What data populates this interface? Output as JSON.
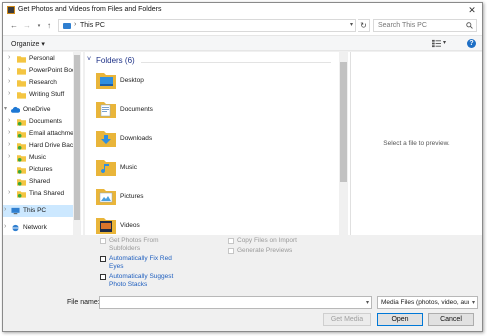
{
  "window": {
    "title": "Get Photos and Videos from Files and Folders"
  },
  "address": {
    "location": "This PC"
  },
  "search": {
    "placeholder": "Search This PC"
  },
  "toolbar": {
    "organize": "Organize ▾"
  },
  "nav_tree": [
    {
      "label": "Personal",
      "icon": "folder-icon",
      "selected": false
    },
    {
      "label": "PowerPoint Boo",
      "icon": "folder-icon",
      "selected": false
    },
    {
      "label": "Research",
      "icon": "folder-icon",
      "selected": false
    },
    {
      "label": "Writing Stuff",
      "icon": "folder-icon",
      "selected": false
    },
    {
      "label": "OneDrive",
      "icon": "cloud-icon",
      "selected": false
    },
    {
      "label": "Documents",
      "icon": "synced-folder-icon",
      "selected": false
    },
    {
      "label": "Email attachmer",
      "icon": "synced-folder-icon",
      "selected": false
    },
    {
      "label": "Hard Drive Backu",
      "icon": "synced-folder-icon",
      "selected": false
    },
    {
      "label": "Music",
      "icon": "synced-folder-icon",
      "selected": false
    },
    {
      "label": "Pictures",
      "icon": "synced-folder-icon",
      "selected": false
    },
    {
      "label": "Shared",
      "icon": "synced-folder-icon",
      "selected": false
    },
    {
      "label": "Tina Shared",
      "icon": "synced-folder-icon",
      "selected": false
    },
    {
      "label": "This PC",
      "icon": "pc-icon",
      "selected": true
    },
    {
      "label": "Network",
      "icon": "network-icon",
      "selected": false
    }
  ],
  "folders_group": {
    "label": "Folders (6)"
  },
  "folders": [
    {
      "label": "Desktop",
      "icon": "desktop-folder-icon"
    },
    {
      "label": "Documents",
      "icon": "documents-folder-icon"
    },
    {
      "label": "Downloads",
      "icon": "downloads-folder-icon"
    },
    {
      "label": "Music",
      "icon": "music-folder-icon"
    },
    {
      "label": "Pictures",
      "icon": "pictures-folder-icon"
    },
    {
      "label": "Videos",
      "icon": "videos-folder-icon"
    }
  ],
  "preview": {
    "text": "Select a file to preview."
  },
  "options": {
    "subfolders_line1": "Get Photos From",
    "subfolders_line2": "Subfolders",
    "fix_red_eyes_line1": "Automatically Fix Red",
    "fix_red_eyes_line2": "Eyes",
    "suggest_stacks_line1": "Automatically Suggest",
    "suggest_stacks_line2": "Photo Stacks",
    "copy_files": "Copy Files on Import",
    "generate_previews": "Generate Previews"
  },
  "bottom": {
    "filename_label": "File name:",
    "filename_value": "",
    "filter_value": "Media Files (photos, video, aud",
    "get_media": "Get Media",
    "open": "Open",
    "cancel": "Cancel"
  },
  "colors": {
    "accent": "#0078d7",
    "link": "#1f5fbf",
    "selection": "#cce8ff",
    "group_header": "#1e3287"
  }
}
